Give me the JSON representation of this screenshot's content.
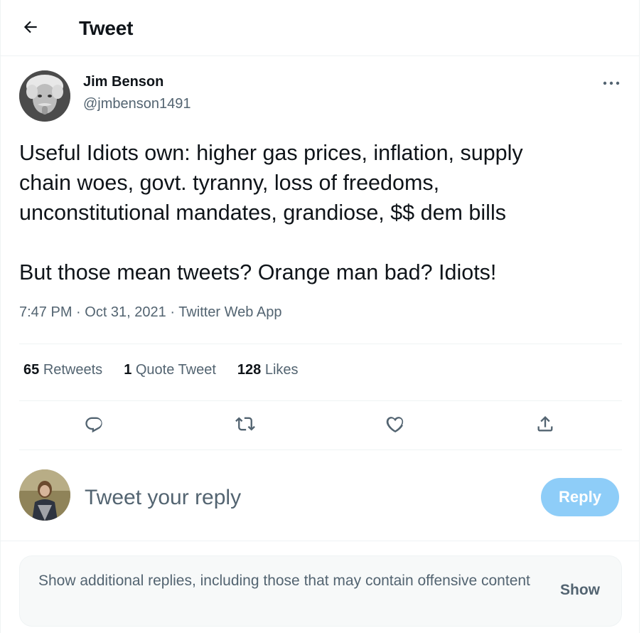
{
  "header": {
    "title": "Tweet",
    "back_icon": "arrow-left-icon"
  },
  "author": {
    "name": "Jim Benson",
    "handle": "@jmbenson1491"
  },
  "tweet": {
    "lines": [
      "Useful Idiots own: higher gas prices, inflation, supply",
      "chain woes, govt. tyranny, loss of freedoms,",
      "unconstitutional mandates, grandiose, $$ dem bills",
      "But those mean tweets? Orange man bad? Idiots!"
    ],
    "meta": "7:47 PM · Oct 31, 2021 · Twitter Web App"
  },
  "stats": {
    "retweets_count": "65",
    "retweets_label": "Retweets",
    "quotes_count": "1",
    "quotes_label": "Quote Tweet",
    "likes_count": "128",
    "likes_label": "Likes"
  },
  "actions": [
    "reply-icon",
    "retweet-icon",
    "like-icon",
    "share-icon"
  ],
  "reply": {
    "placeholder": "Tweet your reply",
    "button_label": "Reply"
  },
  "notice": {
    "text": "Show additional replies, including those that may contain offensive content",
    "show_label": "Show"
  },
  "colors": {
    "accent_disabled": "#8ecdf8",
    "secondary_text": "#536471",
    "border": "#eff3f4"
  }
}
